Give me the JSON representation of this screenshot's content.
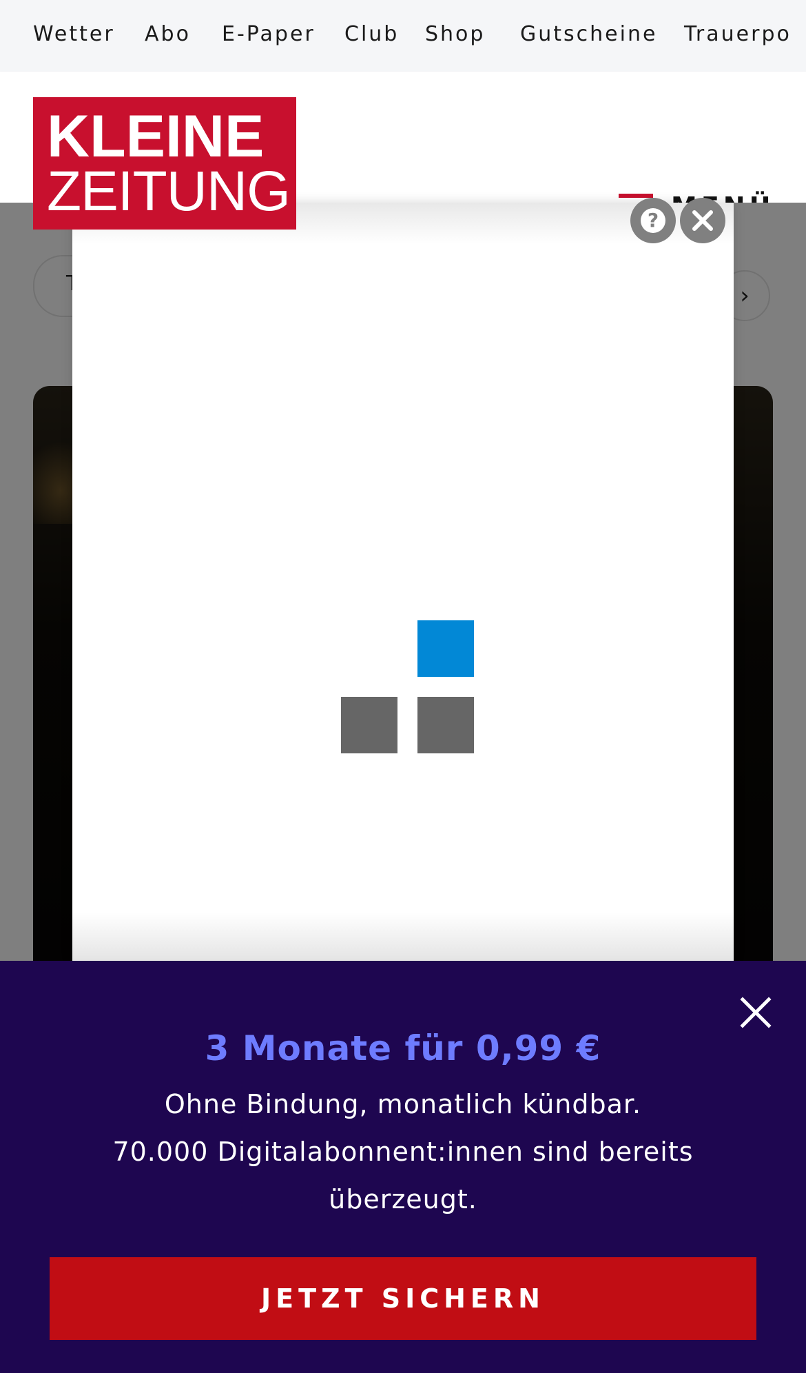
{
  "top_nav": {
    "items": [
      "Wetter",
      "Abo",
      "E-Paper",
      "Club",
      "Shop",
      "Gutscheine",
      "Trauerpo"
    ]
  },
  "header": {
    "logo_line1": "KLEINE",
    "logo_line2": "ZEITUNG",
    "menu_label": "MENÜ",
    "brand_color": "#c8102e"
  },
  "ad_overlay": {
    "loader_colors": [
      "#0288d6",
      "#666666",
      "#666666"
    ],
    "help_icon": "question-icon",
    "close_icon": "close-icon"
  },
  "subscription_banner": {
    "headline": "3 Monate für 0,99 €",
    "line1": "Ohne Bindung, monatlich kündbar.",
    "line2": "70.000 Digitalabonnent:innen sind bereits",
    "line3": "überzeugt.",
    "cta_label": "JETZT SICHERN",
    "background": "#1e0650",
    "headline_color": "#6e7cff",
    "cta_color": "#c10d14"
  }
}
